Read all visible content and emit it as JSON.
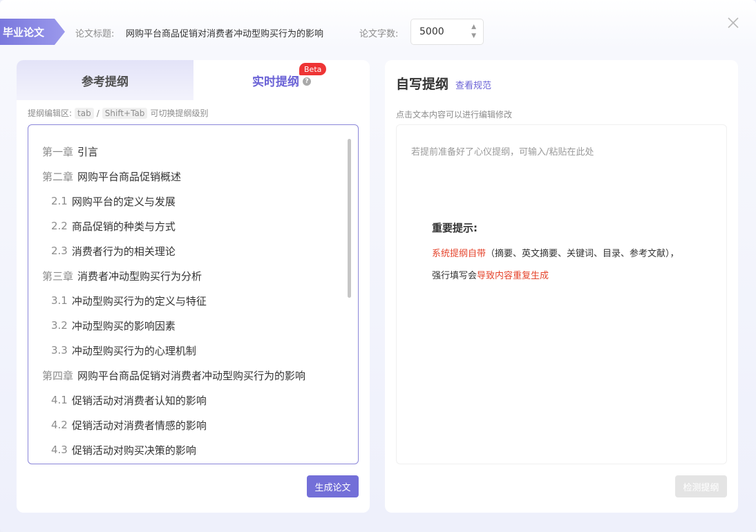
{
  "header": {
    "badge": "毕业论文",
    "title_label": "论文标题:",
    "title_value": "网购平台商品促销对消费者冲动型购买行为的影响",
    "count_label": "论文字数:",
    "count_value": "5000"
  },
  "left": {
    "tab_ref": "参考提纲",
    "tab_live": "实时提纲",
    "beta": "Beta",
    "hint_prefix": "提纲编辑区:",
    "key_tab": "tab",
    "slash": "/",
    "key_shift_tab": "Shift+Tab",
    "hint_suffix": "可切换提纲级别",
    "outline": [
      {
        "num": "第一章",
        "text": "引言",
        "level": 1
      },
      {
        "num": "第二章",
        "text": "网购平台商品促销概述",
        "level": 1
      },
      {
        "num": "2.1",
        "text": "网购平台的定义与发展",
        "level": 2
      },
      {
        "num": "2.2",
        "text": "商品促销的种类与方式",
        "level": 2
      },
      {
        "num": "2.3",
        "text": "消费者行为的相关理论",
        "level": 2
      },
      {
        "num": "第三章",
        "text": "消费者冲动型购买行为分析",
        "level": 1
      },
      {
        "num": "3.1",
        "text": "冲动型购买行为的定义与特征",
        "level": 2
      },
      {
        "num": "3.2",
        "text": "冲动型购买的影响因素",
        "level": 2
      },
      {
        "num": "3.3",
        "text": "冲动型购买行为的心理机制",
        "level": 2
      },
      {
        "num": "第四章",
        "text": "网购平台商品促销对消费者冲动型购买行为的影响",
        "level": 1
      },
      {
        "num": "4.1",
        "text": "促销活动对消费者认知的影响",
        "level": 2
      },
      {
        "num": "4.2",
        "text": "促销活动对消费者情感的影响",
        "level": 2
      },
      {
        "num": "4.3",
        "text": "促销活动对购买决策的影响",
        "level": 2
      }
    ],
    "generate_button": "生成论文"
  },
  "right": {
    "title": "自写提纲",
    "link": "查看规范",
    "hint": "点击文本内容可以进行编辑修改",
    "placeholder": "若提前准备好了心仪提纲，可输入/粘贴在此处",
    "tip_title": "重要提示:",
    "tip_red1": "系统提纲自带",
    "tip_line1_rest": "（摘要、英文摘要、关键词、目录、参考文献），",
    "tip_line2_start": "强行填写会",
    "tip_red2": "导致内容重复生成",
    "check_button": "检测提纲"
  },
  "colors": {
    "accent": "#736fd8",
    "warning": "#e5442c",
    "beta": "#ee3535"
  },
  "icons": {
    "close": "close-icon",
    "help": "help-icon",
    "stepper": "stepper-icon"
  }
}
